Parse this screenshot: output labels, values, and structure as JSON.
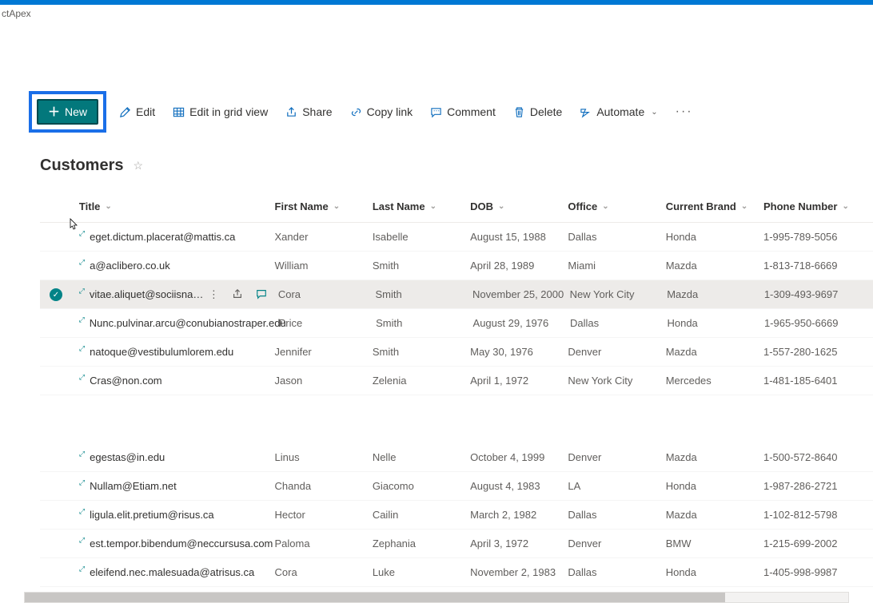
{
  "breadcrumb": "ctApex",
  "toolbar": {
    "new": "New",
    "edit": "Edit",
    "edit_grid": "Edit in grid view",
    "share": "Share",
    "copy_link": "Copy link",
    "comment": "Comment",
    "delete": "Delete",
    "automate": "Automate"
  },
  "page_title": "Customers",
  "columns": {
    "title": "Title",
    "first_name": "First Name",
    "last_name": "Last Name",
    "dob": "DOB",
    "office": "Office",
    "brand": "Current Brand",
    "phone": "Phone Number"
  },
  "rows": [
    {
      "title": "eget.dictum.placerat@mattis.ca",
      "first": "Xander",
      "last": "Isabelle",
      "dob": "August 15, 1988",
      "office": "Dallas",
      "brand": "Honda",
      "phone": "1-995-789-5056"
    },
    {
      "title": "a@aclibero.co.uk",
      "first": "William",
      "last": "Smith",
      "dob": "April 28, 1989",
      "office": "Miami",
      "brand": "Mazda",
      "phone": "1-813-718-6669"
    },
    {
      "title": "vitae.aliquet@sociisnato…",
      "first": "Cora",
      "last": "Smith",
      "dob": "November 25, 2000",
      "office": "New York City",
      "brand": "Mazda",
      "phone": "1-309-493-9697",
      "selected": true
    },
    {
      "title": "Nunc.pulvinar.arcu@conubianostraper.edu",
      "first": "Price",
      "last": "Smith",
      "dob": "August 29, 1976",
      "office": "Dallas",
      "brand": "Honda",
      "phone": "1-965-950-6669"
    },
    {
      "title": "natoque@vestibulumlorem.edu",
      "first": "Jennifer",
      "last": "Smith",
      "dob": "May 30, 1976",
      "office": "Denver",
      "brand": "Mazda",
      "phone": "1-557-280-1625"
    },
    {
      "title": "Cras@non.com",
      "first": "Jason",
      "last": "Zelenia",
      "dob": "April 1, 1972",
      "office": "New York City",
      "brand": "Mercedes",
      "phone": "1-481-185-6401"
    }
  ],
  "rows2": [
    {
      "title": "egestas@in.edu",
      "first": "Linus",
      "last": "Nelle",
      "dob": "October 4, 1999",
      "office": "Denver",
      "brand": "Mazda",
      "phone": "1-500-572-8640"
    },
    {
      "title": "Nullam@Etiam.net",
      "first": "Chanda",
      "last": "Giacomo",
      "dob": "August 4, 1983",
      "office": "LA",
      "brand": "Honda",
      "phone": "1-987-286-2721"
    },
    {
      "title": "ligula.elit.pretium@risus.ca",
      "first": "Hector",
      "last": "Cailin",
      "dob": "March 2, 1982",
      "office": "Dallas",
      "brand": "Mazda",
      "phone": "1-102-812-5798"
    },
    {
      "title": "est.tempor.bibendum@neccursusa.com",
      "first": "Paloma",
      "last": "Zephania",
      "dob": "April 3, 1972",
      "office": "Denver",
      "brand": "BMW",
      "phone": "1-215-699-2002"
    },
    {
      "title": "eleifend.nec.malesuada@atrisus.ca",
      "first": "Cora",
      "last": "Luke",
      "dob": "November 2, 1983",
      "office": "Dallas",
      "brand": "Honda",
      "phone": "1-405-998-9987"
    }
  ]
}
